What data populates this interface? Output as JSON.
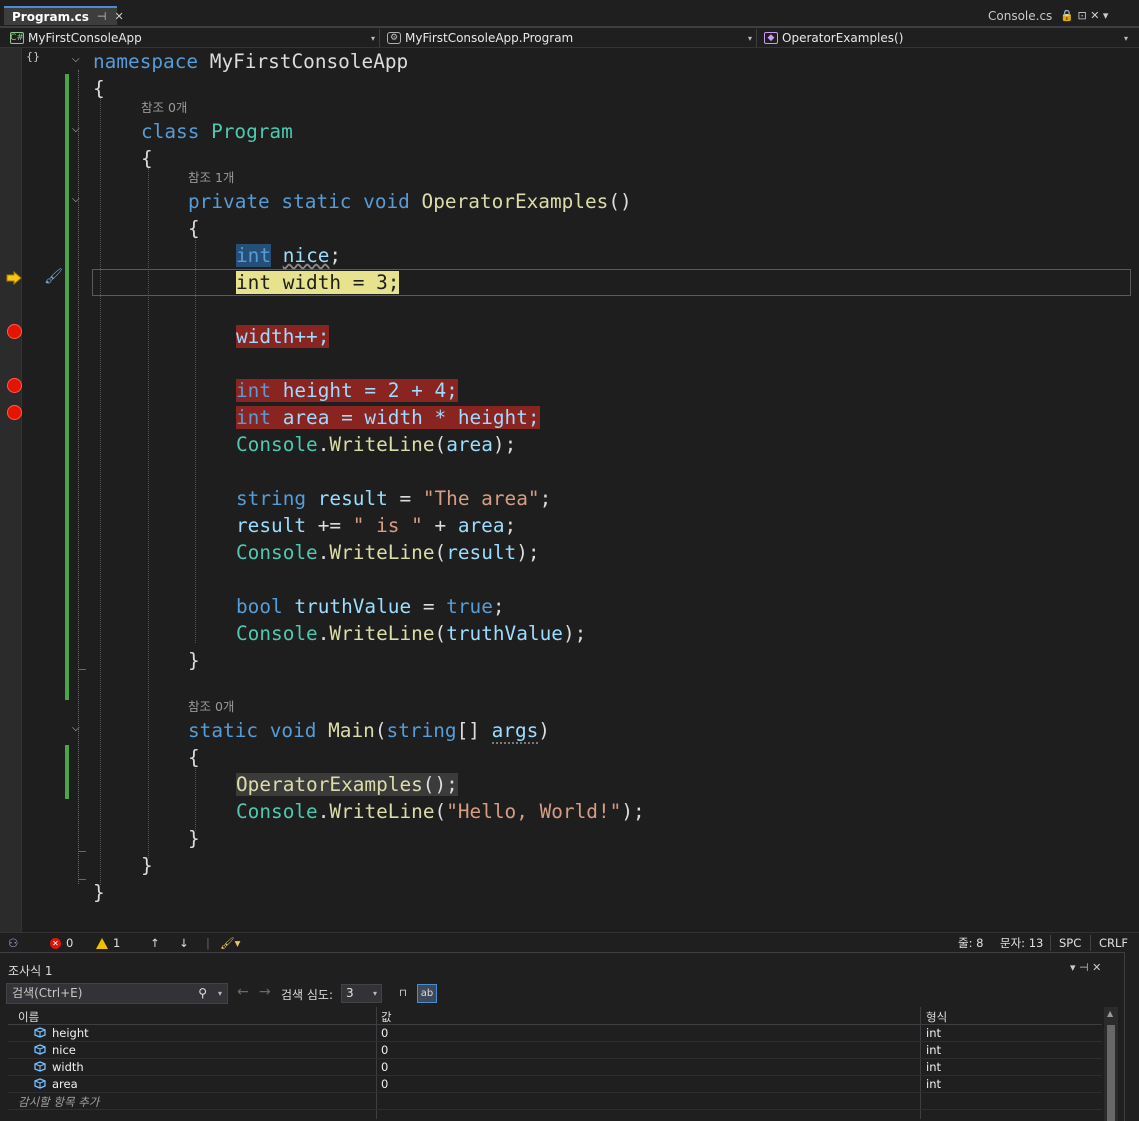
{
  "tabs": {
    "active": "Program.cs",
    "active_pin": "⊣",
    "active_close": "✕",
    "right": "Console.cs",
    "right_icons": "🔒 ⊡ ✕ ▾"
  },
  "nav": {
    "project": "MyFirstConsoleApp",
    "type": "MyFirstConsoleApp.Program",
    "member": "OperatorExamples()",
    "project_icon": "C#"
  },
  "code": {
    "l1": {
      "kw": "namespace",
      "name": "MyFirstConsoleApp"
    },
    "brace_open": "{",
    "brace_close": "}",
    "lens_class": "참조 0개",
    "l3": {
      "kw": "class",
      "name": "Program"
    },
    "lens_method": "참조 1개",
    "l5": {
      "kw1": "private",
      "kw2": "static",
      "kw3": "void",
      "name": "OperatorExamples",
      "rest": "()"
    },
    "l7": {
      "kw": "int",
      "name": "nice",
      "rest": ";"
    },
    "l8": {
      "kw": "int",
      "rest": " width = 3;"
    },
    "l10": {
      "text": "width++;"
    },
    "l12": {
      "kw": "int",
      "rest": " height = 2 + 4;"
    },
    "l13": {
      "kw": "int",
      "rest": " area = width * height;"
    },
    "l14": {
      "ty": "Console",
      "dot": ".",
      "me": "WriteLine",
      "p1": "(",
      "arg": "area",
      "p2": ");"
    },
    "l16": {
      "kw": "string",
      "var": "result",
      "op": " = ",
      "str": "\"The area\"",
      "end": ";"
    },
    "l17": {
      "var": "result",
      "op": " += ",
      "str": "\" is \"",
      "plus": " + ",
      "var2": "area",
      "end": ";"
    },
    "l18": {
      "ty": "Console",
      "dot": ".",
      "me": "WriteLine",
      "p1": "(",
      "arg": "result",
      "p2": ");"
    },
    "l20": {
      "kw": "bool",
      "var": "truthValue",
      "op": " = ",
      "lit": "true",
      "end": ";"
    },
    "l21": {
      "ty": "Console",
      "dot": ".",
      "me": "WriteLine",
      "p1": "(",
      "arg": "truthValue",
      "p2": ");"
    },
    "lens_main": "참조 0개",
    "l24": {
      "kw1": "static",
      "kw2": "void",
      "me": "Main",
      "p1": "(",
      "kw3": "string",
      "br": "[] ",
      "arg": "args",
      "p2": ")"
    },
    "l26": {
      "me": "OperatorExamples",
      "rest": "();"
    },
    "l27": {
      "ty": "Console",
      "dot": ".",
      "me": "WriteLine",
      "p1": "(",
      "str": "\"Hello, World!\"",
      "p2": ");"
    }
  },
  "status": {
    "errors": "0",
    "warnings": "1",
    "line": "줄: 8",
    "col": "문자: 13",
    "spc": "SPC",
    "crlf": "CRLF"
  },
  "watch": {
    "title": "조사식 1",
    "controls": "▾ ⊣ ✕",
    "search_placeholder": "검색(Ctrl+E)",
    "depth_label": "검색 심도:",
    "depth_value": "3",
    "columns": {
      "name": "이름",
      "value": "값",
      "type": "형식"
    },
    "rows": [
      {
        "name": "height",
        "value": "0",
        "type": "int"
      },
      {
        "name": "nice",
        "value": "0",
        "type": "int"
      },
      {
        "name": "width",
        "value": "0",
        "type": "int"
      },
      {
        "name": "area",
        "value": "0",
        "type": "int"
      }
    ],
    "add_row": "감시할 항목 추가"
  },
  "colors": {
    "keyword": "#569cd6",
    "type": "#4ec9b0",
    "method": "#dcdcaa",
    "variable": "#9cdcfe",
    "string": "#d69d85",
    "breakpoint": "#e51400",
    "changebar": "#4ba54a"
  }
}
